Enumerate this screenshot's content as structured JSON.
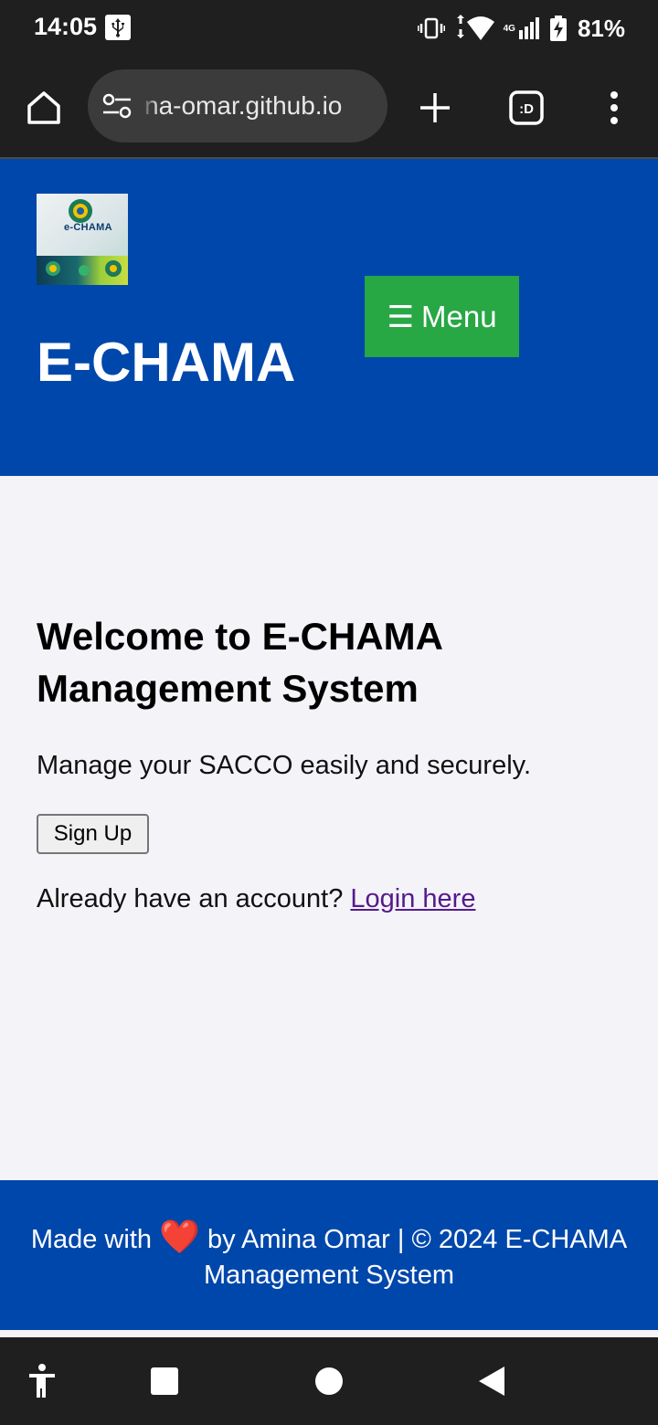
{
  "status_bar": {
    "time": "14:05",
    "network": "4G",
    "battery": "81%"
  },
  "browser": {
    "url": "na-omar.github.io",
    "tab_count_label": ":D"
  },
  "header": {
    "logo_text": "e-CHAMA",
    "menu_icon": "☰",
    "menu_label": "Menu",
    "title": "E-CHAMA"
  },
  "main": {
    "heading": "Welcome to E-CHAMA Management System",
    "tagline": "Manage your SACCO easily and securely.",
    "signup_label": "Sign Up",
    "login_prompt": "Already have an account?",
    "login_link": "Login here"
  },
  "footer": {
    "made_with": "Made with",
    "heart": "❤️",
    "credit": "by Amina Omar | © 2024 E-CHAMA Management System"
  },
  "colors": {
    "brand_blue": "#0047ab",
    "menu_green": "#28a745",
    "page_bg": "#f3f3f8",
    "link_visited": "#551a8b"
  }
}
